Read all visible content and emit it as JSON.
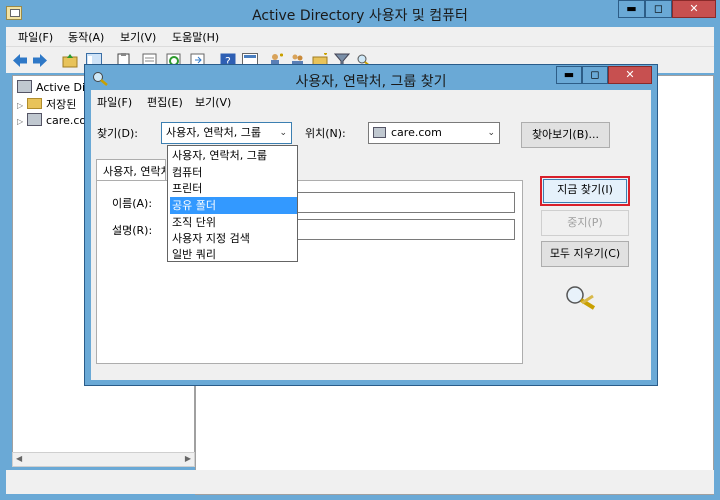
{
  "main_window": {
    "title": "Active Directory 사용자 및 컴퓨터",
    "controls": {
      "minimize": "▬",
      "maximize": "◻",
      "close": "✕"
    },
    "menu": [
      "파일(F)",
      "동작(A)",
      "보기(V)",
      "도움말(H)"
    ]
  },
  "tree": {
    "root": "Active Directory",
    "items": [
      "저장된",
      "care.co"
    ]
  },
  "dialog": {
    "title": "사용자, 연락처, 그룹 찾기",
    "controls": {
      "minimize": "▬",
      "maximize": "◻",
      "close": "✕"
    },
    "menu": [
      "파일(F)",
      "편집(E)",
      "보기(V)"
    ],
    "find_label": "찾기(D):",
    "find_value": "사용자, 연락처, 그룹",
    "location_label": "위치(N):",
    "location_value": "care.com",
    "browse_button": "찾아보기(B)...",
    "tab_label": "사용자, 연락처, 그룹",
    "name_label": "이름(A):",
    "description_label": "설명(R):",
    "find_now_button": "지금 찾기(I)",
    "stop_button": "중지(P)",
    "clear_all_button": "모두 지우기(C)",
    "dropdown_options": [
      "사용자, 연락처, 그룹",
      "컴퓨터",
      "프린터",
      "공유 폴더",
      "조직 단위",
      "사용자 지정 검색",
      "일반 쿼리"
    ],
    "dropdown_selected": "공유 폴더"
  }
}
